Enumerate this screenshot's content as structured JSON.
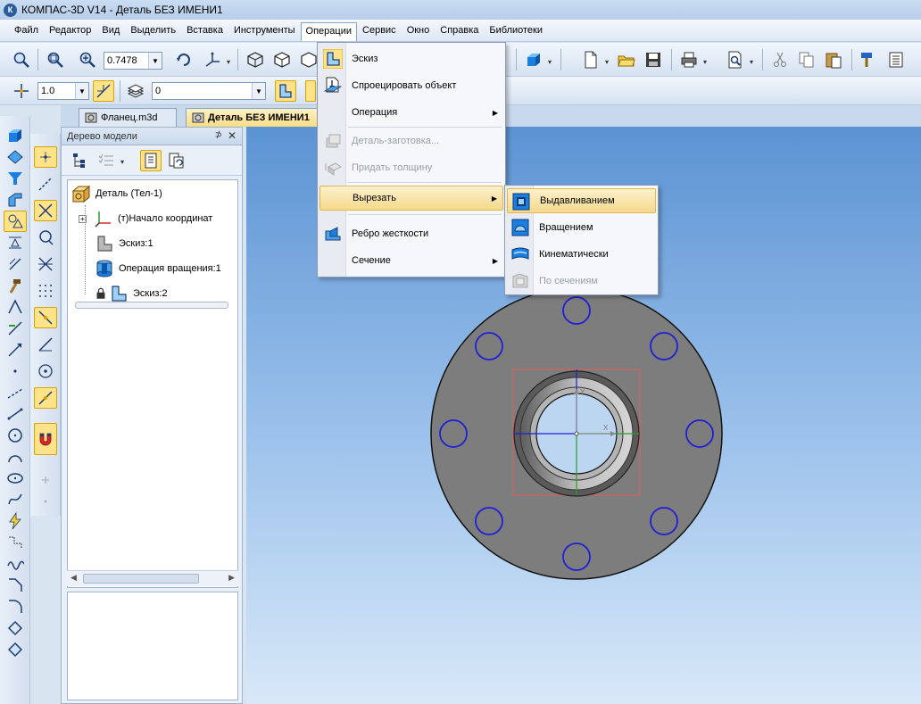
{
  "window": {
    "title": "КОМПАС-3D V14 - Деталь БЕЗ ИМЕНИ1",
    "logo_letter": "К"
  },
  "menubar": {
    "items": [
      {
        "label": "Файл"
      },
      {
        "label": "Редактор"
      },
      {
        "label": "Вид"
      },
      {
        "label": "Выделить"
      },
      {
        "label": "Вставка"
      },
      {
        "label": "Инструменты"
      },
      {
        "label": "Операции"
      },
      {
        "label": "Сервис"
      },
      {
        "label": "Окно"
      },
      {
        "label": "Справка"
      },
      {
        "label": "Библиотеки"
      }
    ],
    "active_index": 6
  },
  "toolbar": {
    "zoom_value": "0.7478",
    "step_value": "1.0",
    "layer_value": "0"
  },
  "tabs": [
    {
      "label": "Фланец.m3d",
      "active": false
    },
    {
      "label": "Деталь БЕЗ ИМЕНИ1",
      "active": true
    }
  ],
  "model_tree": {
    "title": "Дерево модели",
    "pin_glyph": "⊅",
    "close_glyph": "✕",
    "items": [
      {
        "label": "Деталь (Тел-1)",
        "icon": "part-icon"
      },
      {
        "label": "(т)Начало координат",
        "icon": "origin-icon"
      },
      {
        "label": "Эскиз:1",
        "icon": "sketch-icon"
      },
      {
        "label": "Операция вращения:1",
        "icon": "revolve-icon"
      },
      {
        "label": "Эскиз:2",
        "icon": "sketch-icon"
      }
    ]
  },
  "operations_menu": {
    "items": [
      {
        "label": "Эскиз",
        "icon": "sketch-icon",
        "disabled": false,
        "submenu": false
      },
      {
        "label": "Спроецировать объект",
        "icon": "project-icon",
        "disabled": false,
        "submenu": false
      },
      {
        "label": "Операция",
        "icon": "",
        "disabled": false,
        "submenu": true
      },
      {
        "label": "Деталь-заготовка...",
        "icon": "blank-part-icon",
        "disabled": true,
        "submenu": false
      },
      {
        "label": "Придать толщину",
        "icon": "thicken-icon",
        "disabled": true,
        "submenu": false
      },
      {
        "label": "Вырезать",
        "icon": "",
        "disabled": false,
        "submenu": true,
        "highlighted": true
      },
      {
        "label": "Ребро жесткости",
        "icon": "rib-icon",
        "disabled": false,
        "submenu": false
      },
      {
        "label": "Сечение",
        "icon": "",
        "disabled": false,
        "submenu": true
      }
    ]
  },
  "cut_submenu": {
    "items": [
      {
        "label": "Выдавливанием",
        "icon": "cut-extrude-icon",
        "disabled": false,
        "highlighted": true
      },
      {
        "label": "Вращением",
        "icon": "cut-revolve-icon",
        "disabled": false
      },
      {
        "label": "Кинематически",
        "icon": "cut-sweep-icon",
        "disabled": false
      },
      {
        "label": "По сечениям",
        "icon": "cut-loft-icon",
        "disabled": true
      }
    ]
  },
  "axis_labels": {
    "x": "X",
    "y": "Y"
  },
  "colors": {
    "accent_highlight": "#f5d98b",
    "viewport_top": "#5b93d3",
    "flange": "#7d7d7d",
    "holes": "#1f1fd6"
  }
}
